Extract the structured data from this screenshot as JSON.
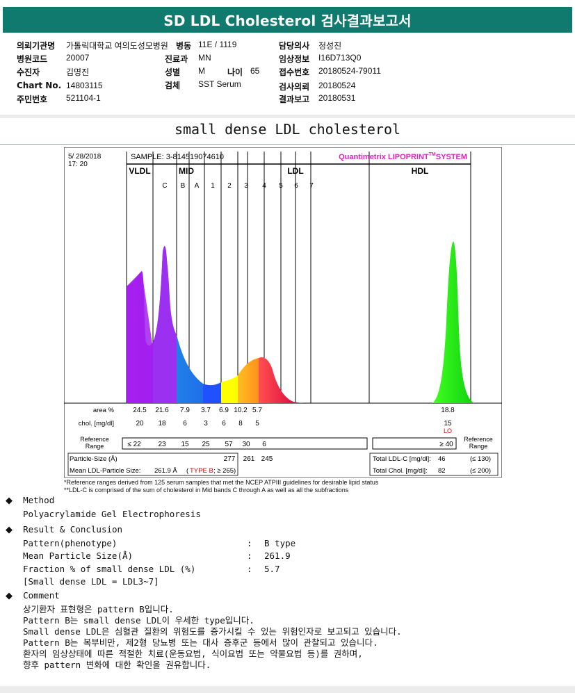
{
  "title": "SD LDL Cholesterol 검사결과보고서",
  "patient_info": {
    "col1": [
      {
        "label": "의뢰기관명",
        "value": "가톨릭대학교 여의도성모병원"
      },
      {
        "label": "병원코드",
        "value": "20007"
      },
      {
        "label": "수진자",
        "value": "김명진"
      },
      {
        "label": "Chart No.",
        "value": "14803115"
      },
      {
        "label": "주민번호",
        "value": "521104-1"
      }
    ],
    "col2": [
      {
        "label": "병동",
        "value": "11E / 1119"
      },
      {
        "label": "진료과",
        "value": "MN"
      },
      {
        "label": "성별",
        "value": "M"
      },
      {
        "label": "검체",
        "value": "SST Serum"
      }
    ],
    "age": {
      "label": "나이",
      "value": "65"
    },
    "col3": [
      {
        "label": "담당의사",
        "value": "정성진"
      },
      {
        "label": "임상정보",
        "value": "I16D713Q0"
      },
      {
        "label": "접수번호",
        "value": "20180524-79011"
      },
      {
        "label": "검사의뢰",
        "value": "20180524"
      },
      {
        "label": "결과보고",
        "value": "20180531"
      }
    ]
  },
  "section_title": "small dense LDL cholesterol",
  "chart_data": {
    "type": "area",
    "date": "5/ 28/2018",
    "time": "17: 20",
    "sample": "SAMPLE:    3-814519074610",
    "system_label": "Quantimetrix LIPOPRINT",
    "system_tm": "TM",
    "system_suffix": "SYSTEM",
    "groups": [
      "VLDL",
      "MID",
      "LDL",
      "HDL"
    ],
    "bands": [
      "C",
      "B",
      "A",
      "1",
      "2",
      "3",
      "4",
      "5",
      "6",
      "7"
    ],
    "area_label": "area %",
    "area_values": [
      "24.5",
      "21.6",
      "7.9",
      "3.7",
      "6.9",
      "10.2",
      "5.7"
    ],
    "area_hdl": "18.8",
    "chol_label": "chol. [mg/dl]",
    "chol_values": [
      "20",
      "18",
      "6",
      "3",
      "6",
      "8",
      "5"
    ],
    "chol_hdl": "15",
    "chol_hdl_flag": "LO",
    "ref_label_1": "Reference",
    "ref_label_2": "Range",
    "ref_values": [
      "≤ 22",
      "23",
      "15",
      "25",
      "57",
      "30",
      "6"
    ],
    "ref_hdl": "≥ 40",
    "particle_label": "Particle-Size (Å)",
    "particle_values": [
      "277",
      "261",
      "245"
    ],
    "mean_label": "Mean LDL-Particle Size:",
    "mean_value": "261.9 Å",
    "mean_type": "TYPE B",
    "mean_ref": "(≥ 265)",
    "total_ldl_label": "Total LDL-C [mg/dl]:",
    "total_ldl_value": "46",
    "total_ldl_ref": "(≤ 130)",
    "total_chol_label": "Total Chol. [mg/dl]:",
    "total_chol_value": "82",
    "total_chol_ref": "(≤ 200)",
    "colors": {
      "vldl": "#a020f0",
      "c": "#b820e8",
      "b": "#1f6fe8",
      "a": "#2050ff",
      "ldl1": "#ffff00",
      "ldl2": "#ffb020",
      "ldl3": "#ff4060",
      "hdl": "#20e820",
      "system": "#e020c0",
      "typeb": "#e00000"
    }
  },
  "footnotes": [
    "*Reference ranges derived from 125 serum samples that met the NCEP ATPIII guidelines for desirable lipid status",
    "**LDL-C is comprised of the sum of cholesterol in Mid bands C through A as well as all the subfractions"
  ],
  "method": {
    "heading": "Method",
    "text": "Polyacrylamide Gel Electrophoresis"
  },
  "result": {
    "heading": "Result & Conclusion",
    "rows": [
      {
        "label": "Pattern(phenotype)",
        "value": "B type"
      },
      {
        "label": "Mean Particle Size(Å)",
        "value": "261.9"
      },
      {
        "label": "Fraction % of small dense LDL (%)",
        "value": "5.7"
      }
    ],
    "note": "[Small dense LDL = LDL3~7]"
  },
  "comment": {
    "heading": "Comment",
    "lines": [
      "상기환자 표현형은 pattern B입니다.",
      "Pattern B는 small dense LDL이 우세한 type입니다.",
      "Small dense LDL은 심혈관 질환의 위험도를 증가시킬 수 있는 위험인자로 보고되고 있습니다.",
      "Pattern B는 복부비만, 제2형 당뇨병 또는 대사 증후군 등에서 많이 관찰되고 있습니다.",
      "환자의 임상상태에 따른 적절한 치료(운동요법, 식이요법 또는 약물요법 등)를 권하며,",
      "향후 pattern 변화에 대한 확인을 권유합니다."
    ]
  }
}
